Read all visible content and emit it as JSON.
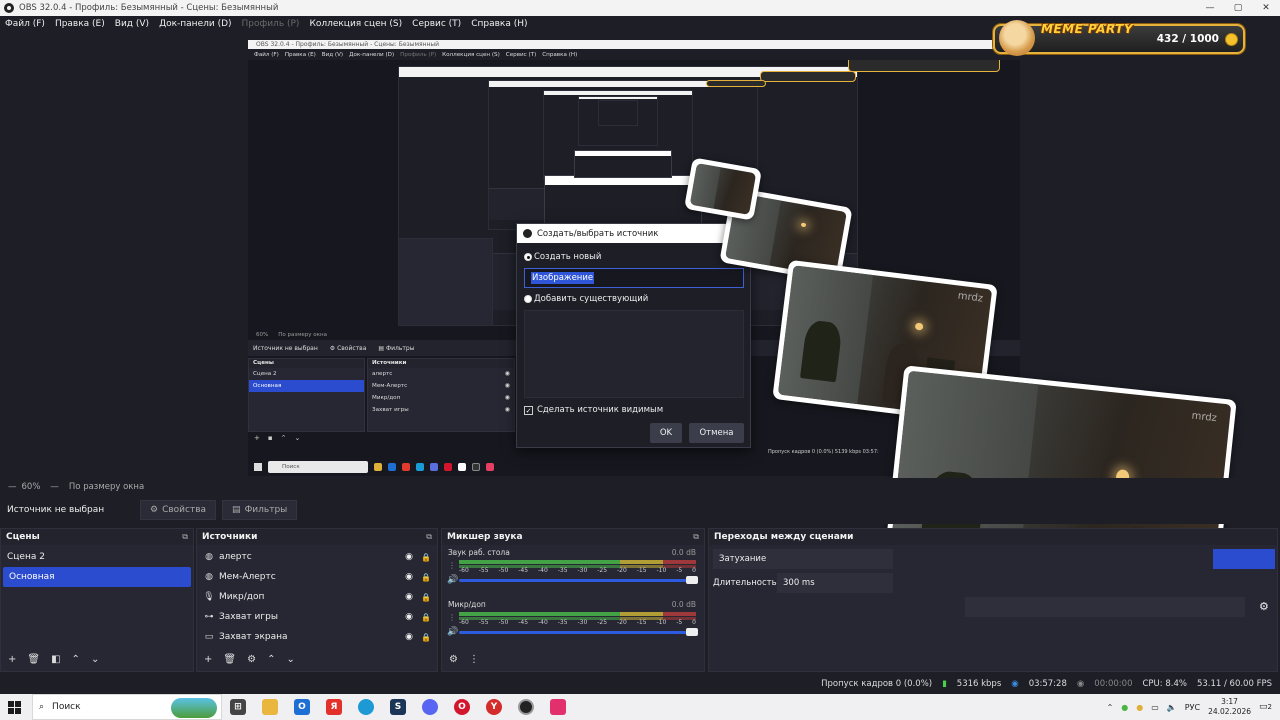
{
  "window": {
    "title": "OBS 32.0.4 - Профиль: Безымянный - Сцены: Безымянный",
    "controls": [
      "—",
      "▢",
      "✕"
    ]
  },
  "menu": [
    {
      "label": "Файл (F)",
      "disabled": false
    },
    {
      "label": "Правка (E)",
      "disabled": false
    },
    {
      "label": "Вид (V)",
      "disabled": false
    },
    {
      "label": "Док-панели (D)",
      "disabled": false
    },
    {
      "label": "Профиль (P)",
      "disabled": true
    },
    {
      "label": "Коллекция сцен (S)",
      "disabled": false
    },
    {
      "label": "Сервис (T)",
      "disabled": false
    },
    {
      "label": "Справка (H)",
      "disabled": false
    }
  ],
  "meme_widget": {
    "brand": "MEME PARTY",
    "count": "432 / 1000",
    "colors": {
      "border": "#e7b23c",
      "brand": "#ffd23d"
    }
  },
  "inner": {
    "title": "OBS 32.0.4 - Профиль: Безымянный - Сцены: Безымянный",
    "menu": [
      "Файл (F)",
      "Правка (E)",
      "Вид (V)",
      "Док-панели (D)",
      "Профиль (P)",
      "Коллекция сцен (S)",
      "Сервис (T)",
      "Справка (H)"
    ],
    "zoom": "60%",
    "zoom_mode": "По размеру окна",
    "context_label": "Источник не выбран",
    "properties": "Свойства",
    "filters": "Фильтры",
    "scenes_title": "Сцены",
    "scenes": [
      "Сцена 2",
      "Основная"
    ],
    "sources_title": "Источники",
    "sources": [
      "алертс",
      "Мем-Алертс",
      "Микр/доп",
      "Захват игры",
      "Захват экрана"
    ],
    "search": "Поиск",
    "status": "Пропуск кадров 0 (0.0%)   5139 kbps   03:57:"
  },
  "dialog": {
    "title": "Создать/выбрать источник",
    "create_new": "Создать новый",
    "name_value": "Изображение",
    "add_existing": "Добавить существующий",
    "make_visible": "Сделать источник видимым",
    "ok": "OK",
    "cancel": "Отмена"
  },
  "photo_watermark": "mrdz",
  "preview": {
    "zoom": "60%",
    "zoom_mode": "По размеру окна"
  },
  "context": {
    "no_selection": "Источник не выбран",
    "properties": "Свойства",
    "filters": "Фильтры"
  },
  "scenes": {
    "title": "Сцены",
    "items": [
      "Сцена 2",
      "Основная"
    ],
    "selected": "Основная"
  },
  "sources": {
    "title": "Источники",
    "items": [
      {
        "name": "алертс",
        "icon": "globe-icon"
      },
      {
        "name": "Мем-Алертс",
        "icon": "globe-icon"
      },
      {
        "name": "Микр/доп",
        "icon": "mic-icon"
      },
      {
        "name": "Захват игры",
        "icon": "gamepad-icon"
      },
      {
        "name": "Захват экрана",
        "icon": "monitor-icon"
      }
    ]
  },
  "mixer": {
    "title": "Микшер звука",
    "channels": [
      {
        "name": "Звук раб. стола",
        "db": "0.0 dB"
      },
      {
        "name": "Микр/доп",
        "db": "0.0 dB"
      }
    ],
    "scale": [
      "-60",
      "-55",
      "-50",
      "-45",
      "-40",
      "-35",
      "-30",
      "-25",
      "-20",
      "-15",
      "-10",
      "-5",
      "0"
    ]
  },
  "transitions": {
    "title": "Переходы между сценами",
    "type": "Затухание",
    "duration_label": "Длительность",
    "duration_value": "300 ms"
  },
  "status": {
    "dropped": "Пропуск кадров 0 (0.0%)",
    "bitrate": "5316 kbps",
    "stream_time": "03:57:28",
    "rec_time": "00:00:00",
    "cpu": "CPU: 8.4%",
    "fps": "53.11 / 60.00 FPS"
  },
  "taskbar": {
    "search": "Поиск",
    "lang": "РУС",
    "time": "3:17",
    "date": "24.02.2026",
    "notifications": "2"
  }
}
